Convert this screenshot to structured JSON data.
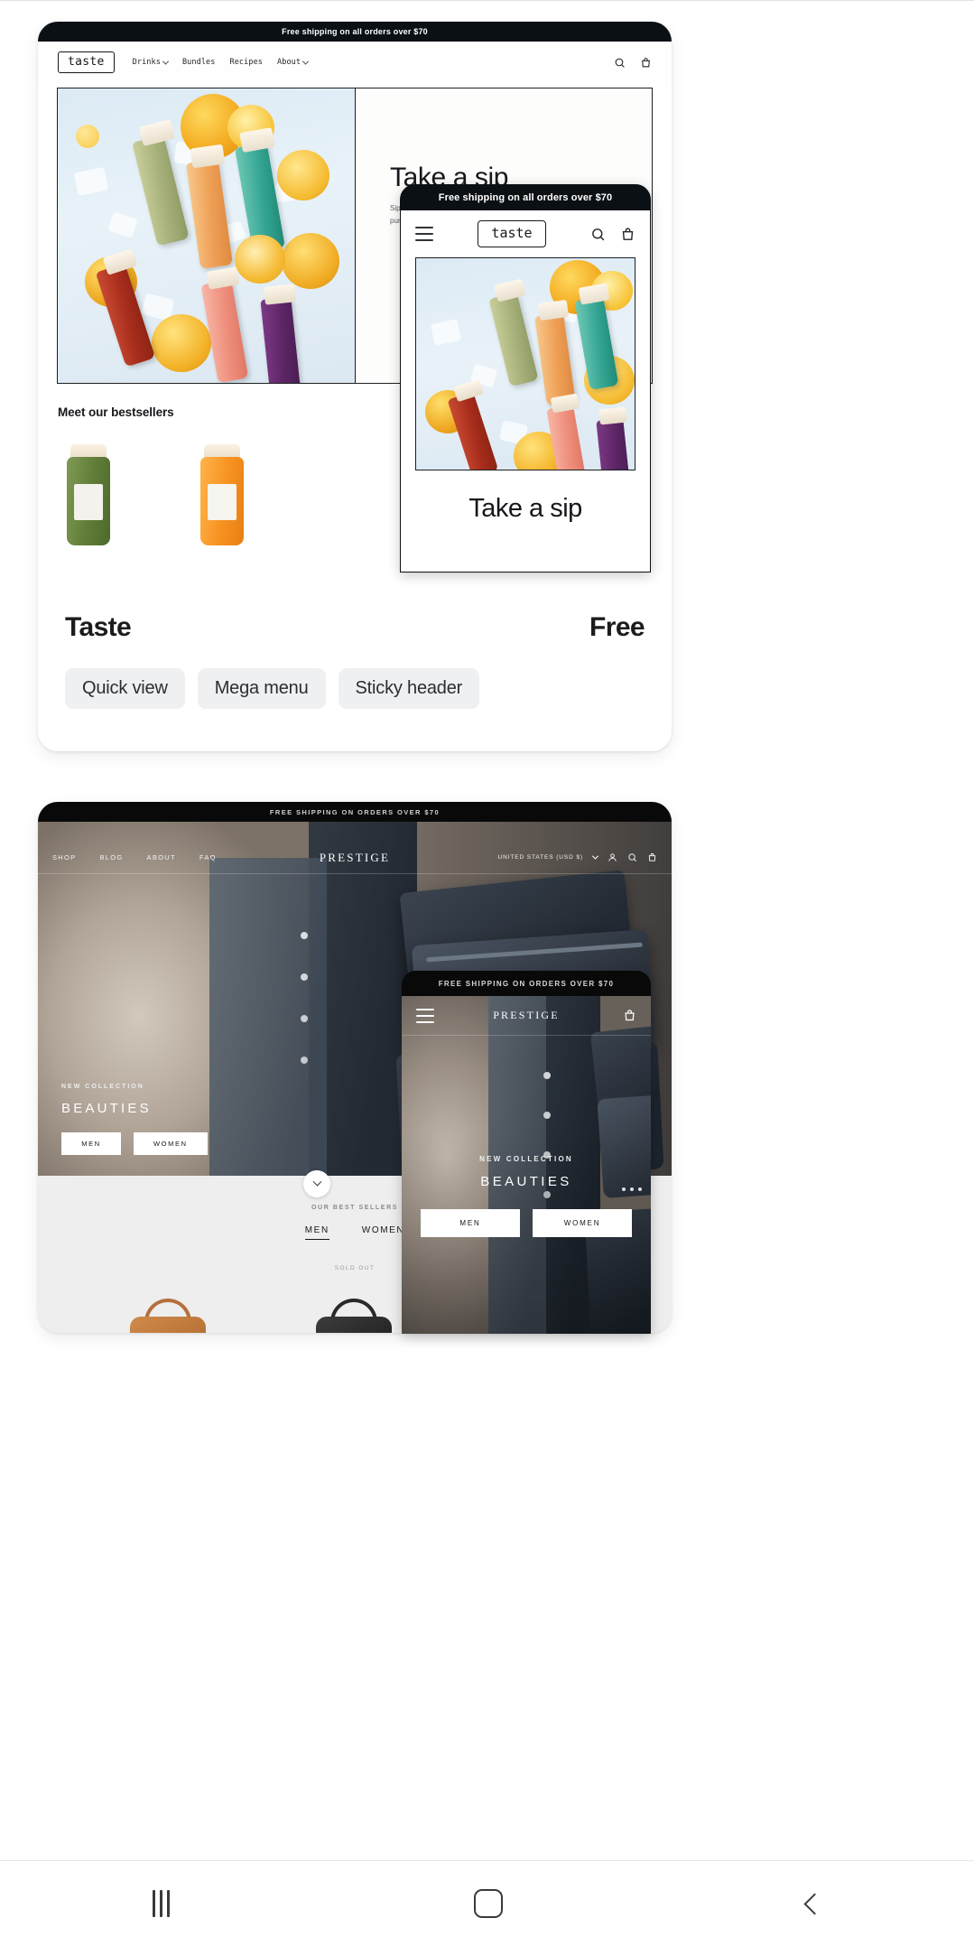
{
  "taste": {
    "announcement": "Free shipping on all orders over $70",
    "logo": "taste",
    "nav": [
      {
        "label": "Drinks",
        "caret": true
      },
      {
        "label": "Bundles",
        "caret": false
      },
      {
        "label": "Recipes",
        "caret": false
      },
      {
        "label": "About",
        "caret": true
      }
    ],
    "icons": [
      "search-icon",
      "cart-icon"
    ],
    "hero": {
      "heading": "Take a sip",
      "sub_line1": "Sip into something refreshing, made",
      "sub_line2": "pure and squeezed with care."
    },
    "bestsellers_title": "Meet our bestsellers",
    "theme_name": "Taste",
    "price": "Free",
    "tags": [
      "Quick view",
      "Mega menu",
      "Sticky header"
    ],
    "mobile": {
      "announcement": "Free shipping on all orders over $70",
      "logo": "taste",
      "menu_icon": "hamburger-icon",
      "icons": [
        "search-icon",
        "cart-icon"
      ],
      "heading": "Take a sip"
    }
  },
  "prestige": {
    "announcement": "FREE SHIPPING ON ORDERS OVER $70",
    "brand": "PRESTIGE",
    "nav": [
      "SHOP",
      "BLOG",
      "ABOUT",
      "FAQ"
    ],
    "currency": "UNITED STATES (USD $)",
    "icons": [
      "account-icon",
      "search-icon",
      "cart-icon"
    ],
    "hero": {
      "eyebrow": "NEW COLLECTION",
      "heading": "BEAUTIES",
      "buttons": [
        "MEN",
        "WOMEN"
      ]
    },
    "lower": {
      "eyebrow": "OUR BEST SELLERS",
      "tabs": [
        {
          "label": "MEN",
          "active": true
        },
        {
          "label": "WOMEN",
          "active": false
        }
      ],
      "sold_out": "SOLD OUT"
    },
    "mobile": {
      "announcement": "FREE SHIPPING ON ORDERS OVER $70",
      "brand": "PRESTIGE",
      "menu_icon": "hamburger-icon",
      "cart_icon": "cart-icon",
      "eyebrow": "NEW COLLECTION",
      "heading": "BEAUTIES",
      "buttons": [
        "MEN",
        "WOMEN"
      ]
    }
  },
  "system_nav": {
    "recents": "recents-icon",
    "home": "home-icon",
    "back": "back-icon"
  },
  "colors": {
    "dark": "#0b1014",
    "chip_bg": "#eff0f2",
    "prestige_bg": "#eeeeee"
  }
}
